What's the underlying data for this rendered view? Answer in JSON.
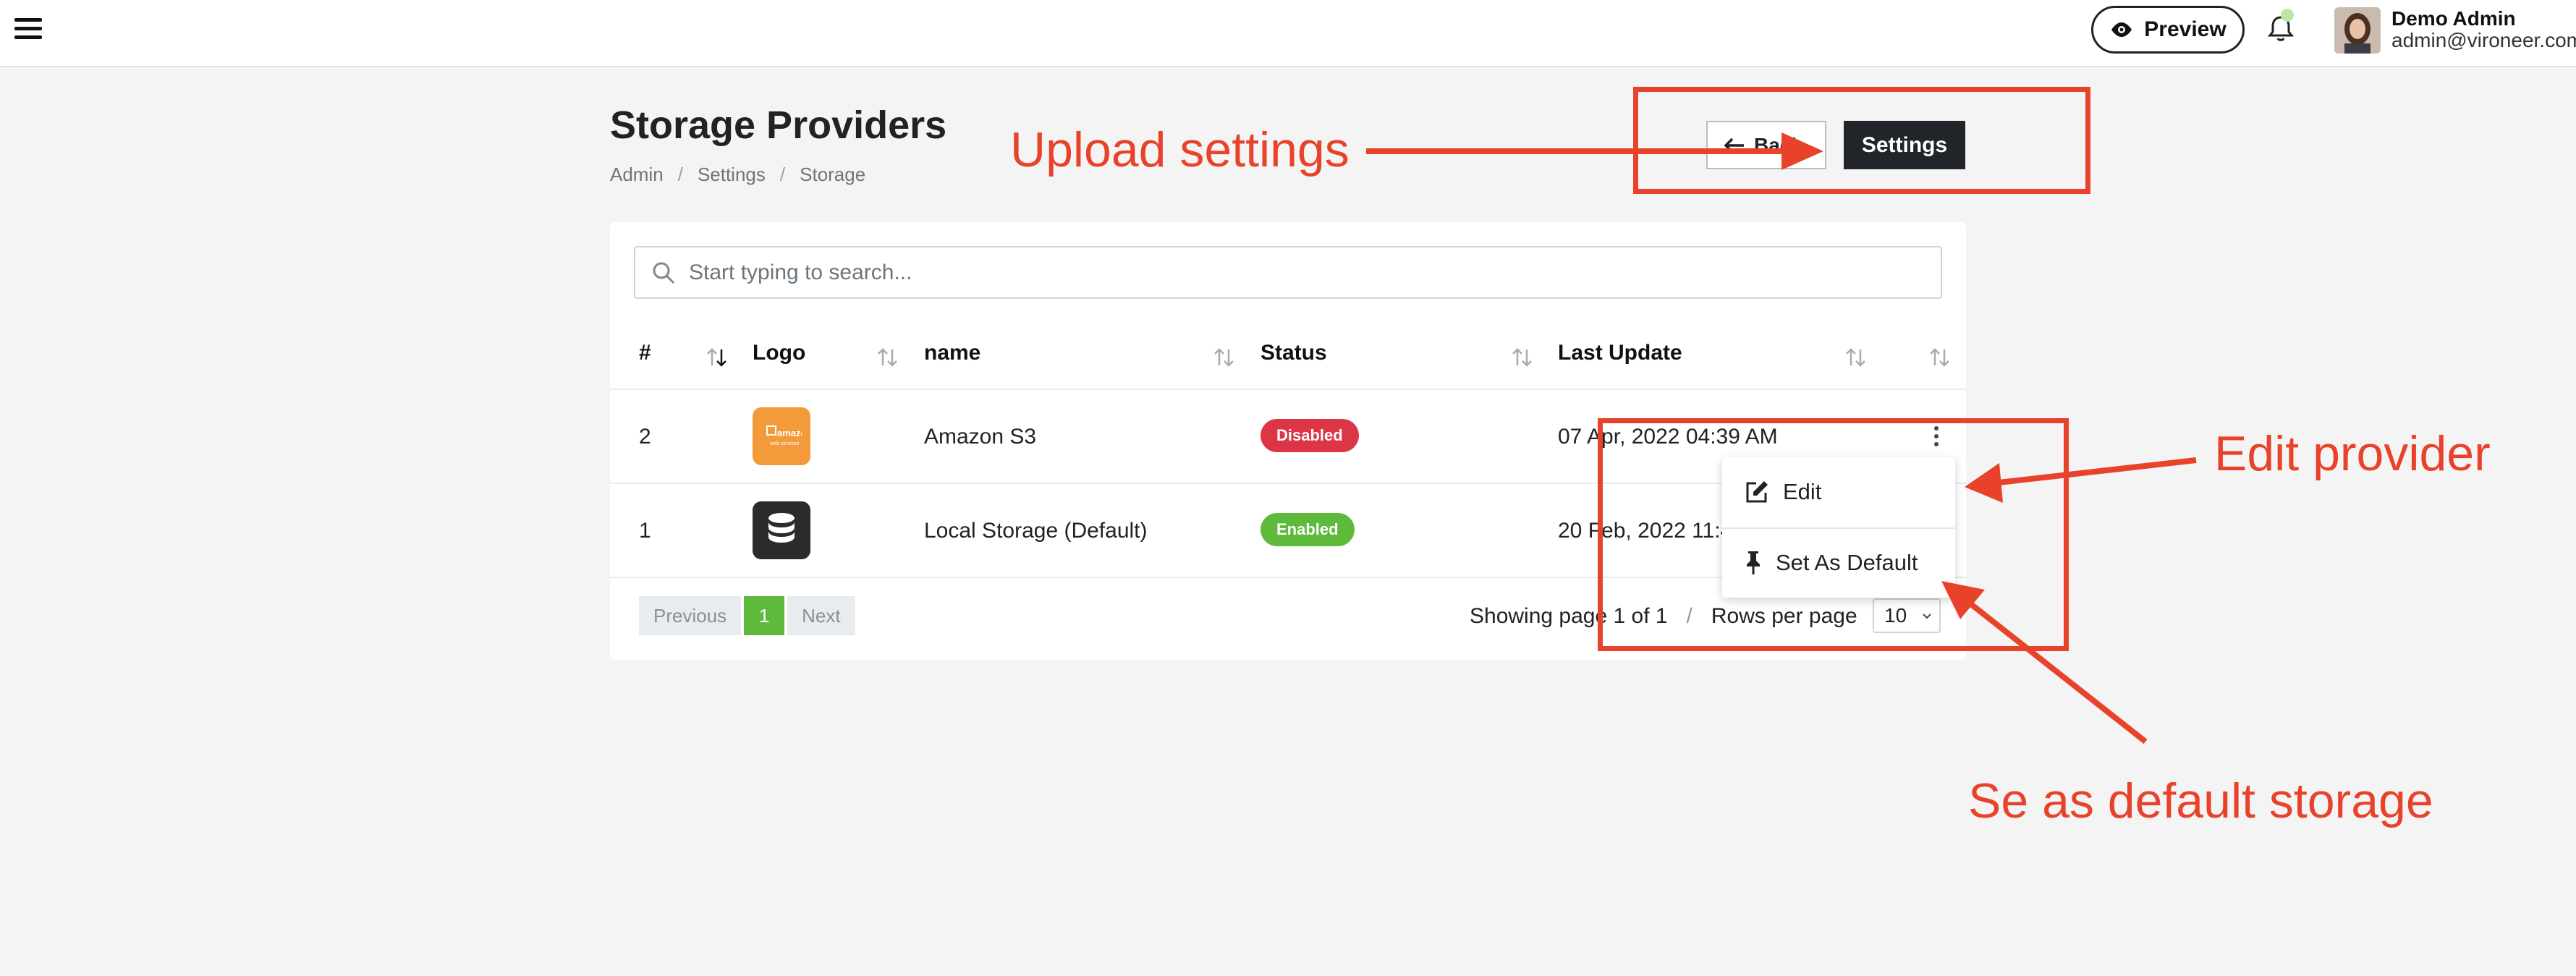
{
  "topbar": {
    "preview_label": "Preview",
    "user_name": "Demo Admin",
    "user_email": "admin@vironeer.com"
  },
  "header": {
    "title": "Storage Providers",
    "breadcrumb": [
      "Admin",
      "Settings",
      "Storage"
    ],
    "back_label": "Back",
    "settings_label": "Settings"
  },
  "search": {
    "placeholder": "Start typing to search..."
  },
  "table": {
    "columns": [
      "#",
      "Logo",
      "name",
      "Status",
      "Last Update"
    ],
    "rows": [
      {
        "id": "2",
        "logo": "amazon-s3-logo",
        "name": "Amazon S3",
        "status": "Disabled",
        "last_update": "07 Apr, 2022 04:39 AM"
      },
      {
        "id": "1",
        "logo": "database-icon",
        "name": "Local Storage (Default)",
        "status": "Enabled",
        "last_update": "20 Feb, 2022 11:4"
      }
    ]
  },
  "menu": {
    "edit_label": "Edit",
    "set_default_label": "Set As Default"
  },
  "pagination": {
    "previous_label": "Previous",
    "current_page": "1",
    "next_label": "Next",
    "showing_text": "Showing page 1 of 1",
    "separator": "/",
    "rows_per_page_label": "Rows per page",
    "rows_per_page_value": "10"
  },
  "annotations": {
    "upload_settings": "Upload settings",
    "edit_provider": "Edit provider",
    "set_default": "Se as default storage",
    "color": "#e8432a"
  },
  "colors": {
    "disabled_badge": "#dc3545",
    "enabled_badge": "#5fba3c",
    "amazon_logo_bg": "#f39a3a",
    "local_logo_bg": "#2b2b2b"
  }
}
